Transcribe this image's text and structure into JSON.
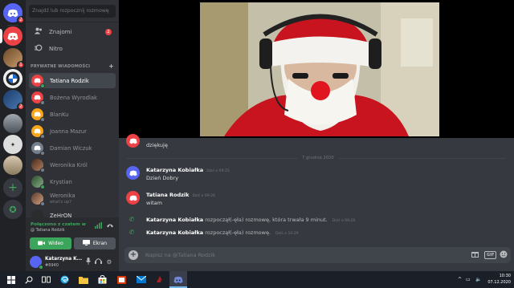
{
  "colors": {
    "accent": "#5865f2",
    "online": "#3ba55c",
    "danger": "#ed4245",
    "background": "#36393f",
    "sidebar": "#2f3136"
  },
  "servers": [
    {
      "name": "Discord home",
      "icon": "discord-icon",
      "badge": "2"
    },
    {
      "name": "Server",
      "icon": "discord-icon",
      "badge": ""
    },
    {
      "name": "Server",
      "icon": "avatar",
      "badge": "1"
    },
    {
      "name": "Server",
      "icon": "avatar",
      "badge": ""
    },
    {
      "name": "Server",
      "icon": "bmw-logo",
      "badge": ""
    },
    {
      "name": "Server",
      "icon": "avatar",
      "badge": "2"
    },
    {
      "name": "Server",
      "icon": "avatar",
      "badge": ""
    },
    {
      "name": "Server",
      "icon": "avatar",
      "badge": ""
    },
    {
      "name": "Server",
      "icon": "avatar",
      "badge": ""
    },
    {
      "name": "Server",
      "icon": "avatar",
      "badge": ""
    }
  ],
  "search": {
    "placeholder": "Znajdź lub rozpocznij rozmowę"
  },
  "nav": {
    "friends": "Znajomi",
    "friends_badge": "2",
    "nitro": "Nitro"
  },
  "dm_header": "PRYWATNE WIADOMOŚCI",
  "dms": [
    {
      "name": "Tatiana Rodzik",
      "sub": "",
      "active": true,
      "color": "#ed4245",
      "online": true
    },
    {
      "name": "Bożena Wyrodlak",
      "sub": "",
      "active": false,
      "color": "#ed4245",
      "online": false
    },
    {
      "name": "BlanKu",
      "sub": "",
      "active": false,
      "color": "#faa61a",
      "online": false
    },
    {
      "name": "Joanna Mazur",
      "sub": "",
      "active": false,
      "color": "#faa61a",
      "online": false
    },
    {
      "name": "Damian Wiczuk",
      "sub": "",
      "active": false,
      "color": "#747f8d",
      "online": false
    },
    {
      "name": "Weronika Król",
      "sub": "",
      "active": false,
      "color": "#6b4a3a",
      "online": false
    },
    {
      "name": "Krystian",
      "sub": "",
      "active": false,
      "color": "#3ba55c",
      "online": true
    },
    {
      "name": "Weronika",
      "sub": "what's up?",
      "active": false,
      "color": "#8a6a5a",
      "online": false
    },
    {
      "name": "ZeHrON",
      "sub": "",
      "active": false,
      "color": "#2c2c2c",
      "online": false
    }
  ],
  "voice": {
    "status": "Połączono z czatem w",
    "channel": "@ Tatiana Rodzik",
    "video_label": "Wideo",
    "screen_label": "Ekran"
  },
  "user": {
    "name": "Katarzyna K...",
    "tag": "#6940"
  },
  "messages": {
    "partial_text": "dziękuję",
    "date_divider": "7 grudnia 2020",
    "items": [
      {
        "author": "Katarzyna Kobiałka",
        "time": "Dziś o 09:25",
        "text": "Dzień Dobry",
        "color": "#5865f2"
      },
      {
        "author": "Tatiana Rodzik",
        "time": "Dziś o 09:26",
        "text": "witam",
        "color": "#ed4245"
      }
    ],
    "calls": [
      {
        "author": "Katarzyna Kobiałka",
        "text": "rozpoczął(-ęła) rozmowę, która trwała 9 minut.",
        "time": "Dziś o 09:26"
      },
      {
        "author": "Katarzyna Kobiałka",
        "text": "rozpoczął(-ęła) rozmowę.",
        "time": "Dziś o 10:29"
      }
    ]
  },
  "composer": {
    "placeholder": "Napisz na @Tatiana Rodzik",
    "gif_label": "GIF"
  },
  "taskbar": {
    "time": "10:30",
    "date": "07.12.2020"
  }
}
